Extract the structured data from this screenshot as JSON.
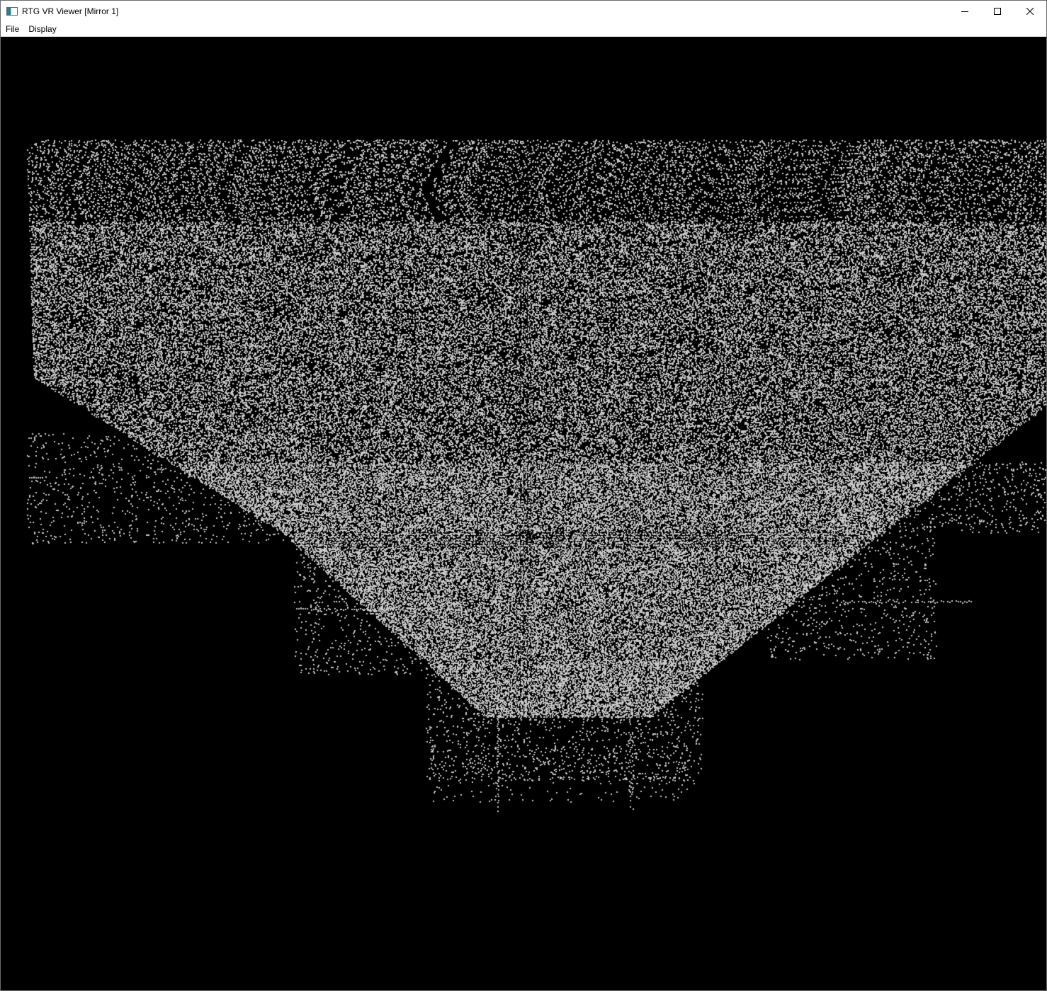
{
  "window": {
    "title": "RTG VR Viewer [Mirror 1]",
    "app_icon": "window-app-icon",
    "controls": {
      "minimize_icon": "minimize-icon",
      "maximize_icon": "maximize-icon",
      "close_icon": "close-icon"
    }
  },
  "menu": {
    "items": [
      {
        "label": "File"
      },
      {
        "label": "Display"
      }
    ]
  },
  "viewport": {
    "background_color": "#000000",
    "point_color": "#c8c8c8"
  }
}
